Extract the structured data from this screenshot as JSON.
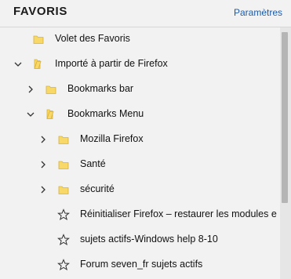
{
  "header": {
    "title": "FAVORIS",
    "settings_label": "Paramètres"
  },
  "tree": [
    {
      "label": "Volet des Favoris",
      "type": "folder",
      "expander": "none",
      "icon": "folder-icon"
    },
    {
      "label": "Importé à partir de Firefox",
      "type": "folder",
      "expander": "expanded",
      "icon": "folder-open-icon"
    },
    {
      "label": "Bookmarks bar",
      "type": "folder",
      "expander": "collapsed",
      "icon": "folder-icon"
    },
    {
      "label": "Bookmarks Menu",
      "type": "folder",
      "expander": "expanded",
      "icon": "folder-open-icon"
    },
    {
      "label": "Mozilla Firefox",
      "type": "folder",
      "expander": "collapsed",
      "icon": "folder-icon"
    },
    {
      "label": "Santé",
      "type": "folder",
      "expander": "collapsed",
      "icon": "folder-icon"
    },
    {
      "label": "sécurité",
      "type": "folder",
      "expander": "collapsed",
      "icon": "folder-icon"
    },
    {
      "label": "Réinitialiser Firefox – restaurer les modules e",
      "type": "bookmark",
      "expander": "none",
      "icon": "star-icon"
    },
    {
      "label": "sujets actifs-Windows help 8-10",
      "type": "bookmark",
      "expander": "none",
      "icon": "star-icon"
    },
    {
      "label": "Forum seven_fr sujets actifs",
      "type": "bookmark",
      "expander": "none",
      "icon": "star-icon"
    }
  ],
  "colors": {
    "accent_link": "#1d5aa8",
    "folder_fill": "#f7d868",
    "background": "#f2f2f2"
  }
}
